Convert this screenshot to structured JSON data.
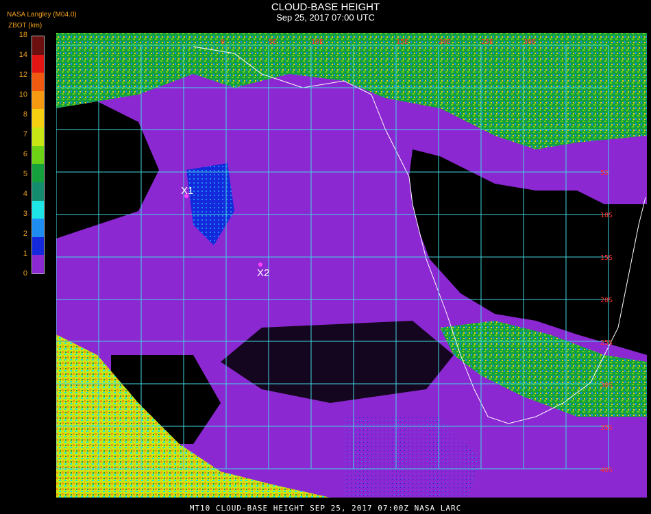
{
  "header": {
    "organization": "NASA Langley (M04.0)",
    "units": "ZBOT (km)",
    "title": "CLOUD-BASE HEIGHT",
    "subtitle": "Sep 25, 2017 07:00 UTC"
  },
  "colorbar": {
    "ticks": [
      "18",
      "14",
      "12",
      "10",
      "8",
      "7",
      "6",
      "5",
      "4",
      "3",
      "2",
      "1",
      "0"
    ],
    "colors": [
      "#6b0f0f",
      "#e31414",
      "#f05a10",
      "#f59a10",
      "#f5d010",
      "#c8e614",
      "#6ed214",
      "#14a03c",
      "#148c6e",
      "#1ee6e6",
      "#1e8cf0",
      "#1428dc",
      "#8c28d2"
    ]
  },
  "markers": [
    {
      "label": "X1"
    },
    {
      "label": "X2"
    }
  ],
  "grid_labels": [
    "0",
    "5E",
    "10E",
    "15E",
    "20E",
    "25E",
    "30E",
    "5S",
    "10S",
    "15S",
    "20S",
    "25S",
    "30S",
    "35S",
    "40S"
  ],
  "footer": "MT10  CLOUD-BASE HEIGHT   SEP 25, 2017 07:00Z   NASA LARC",
  "colors": {
    "ocean_cloud": "#8c28d2",
    "clear": "#000000",
    "grid": "#40d8e0",
    "coast": "#ffffff",
    "label_accent": "#f0a020"
  }
}
